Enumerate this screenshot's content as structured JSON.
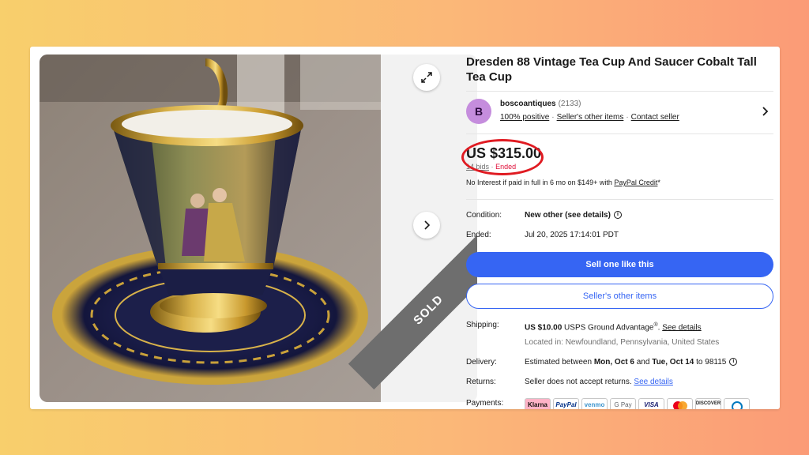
{
  "listing": {
    "title": "Dresden 88 Vintage Tea Cup And Saucer Cobalt Tall Tea Cup",
    "sold_label": "SOLD"
  },
  "gallery": {
    "expand_icon": "expand-icon",
    "next_icon": "chevron-right-icon"
  },
  "seller": {
    "avatar_letter": "B",
    "name": "boscoantiques",
    "feedback_count": "(2133)",
    "positive": "100% positive",
    "other_items_link": "Seller's other items",
    "contact_link": "Contact seller",
    "separator": "·"
  },
  "price": {
    "amount": "US $315.00",
    "bids": "14 bids",
    "separator": "·",
    "status": "Ended"
  },
  "financing": {
    "text_before": "No Interest if paid in full in 6 mo on $149+ with ",
    "link": "PayPal Credit",
    "suffix": "*"
  },
  "condition": {
    "label": "Condition:",
    "value": "New other (see details)"
  },
  "ended": {
    "label": "Ended:",
    "value": "Jul 20, 2025 17:14:01 PDT"
  },
  "actions": {
    "sell_one": "Sell one like this",
    "sellers_other_items": "Seller's other items"
  },
  "shipping": {
    "label": "Shipping:",
    "cost": "US $10.00",
    "service": "USPS Ground Advantage",
    "registered": "®",
    "period": ".",
    "details_link": "See details",
    "location": "Located in: Newfoundland, Pennsylvania, United States"
  },
  "delivery": {
    "label": "Delivery:",
    "prefix": "Estimated between ",
    "start": "Mon, Oct 6",
    "middle": " and ",
    "end": "Tue, Oct 14",
    "suffix": " to 98115"
  },
  "returns": {
    "label": "Returns:",
    "text": "Seller does not accept returns. ",
    "details_link": "See details"
  },
  "payments": {
    "label": "Payments:",
    "methods": [
      "Klarna",
      "PayPal",
      "venmo",
      "G Pay",
      "VISA",
      "",
      "DISCOVER",
      ""
    ]
  },
  "colors": {
    "accent": "#3665f3",
    "ended_red": "#e0103a",
    "annotation_red": "#e01b22",
    "avatar": "#c58ddd",
    "sold_ribbon": "#6e6e6e"
  }
}
